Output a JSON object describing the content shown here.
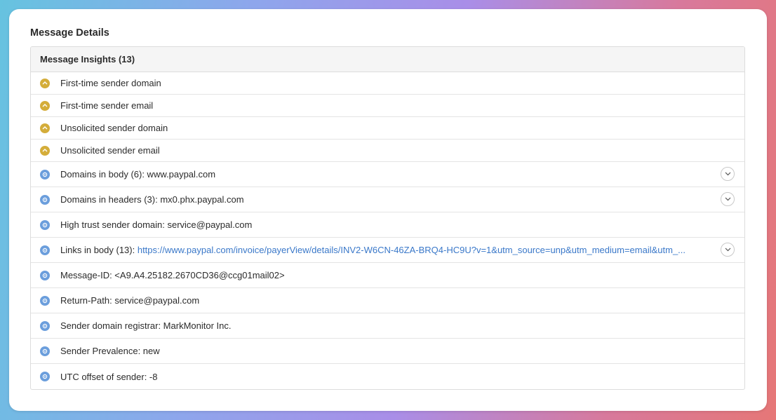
{
  "title": "Message Details",
  "insights_header": "Message Insights (13)",
  "colors": {
    "warning": "#d4ad3a",
    "info": "#6b9edc",
    "link": "#3a78c9"
  },
  "items": [
    {
      "icon": "warning-icon",
      "label": "First-time sender domain"
    },
    {
      "icon": "warning-icon",
      "label": "First-time sender email"
    },
    {
      "icon": "warning-icon",
      "label": "Unsolicited sender domain"
    },
    {
      "icon": "warning-icon",
      "label": "Unsolicited sender email"
    },
    {
      "icon": "info-icon",
      "label": "Domains in body (6): www.paypal.com",
      "expandable": true
    },
    {
      "icon": "info-icon",
      "label": "Domains in headers (3): mx0.phx.paypal.com",
      "expandable": true
    },
    {
      "icon": "info-icon",
      "label": "High trust sender domain: service@paypal.com"
    },
    {
      "icon": "info-icon",
      "label": "Links in body (13): ",
      "link": "https://www.paypal.com/invoice/payerView/details/INV2-W6CN-46ZA-BRQ4-HC9U?v=1&utm_source=unp&utm_medium=email&utm_...",
      "expandable": true
    },
    {
      "icon": "info-icon",
      "label": "Message-ID: <A9.A4.25182.2670CD36@ccg01mail02>"
    },
    {
      "icon": "info-icon",
      "label": "Return-Path: service@paypal.com"
    },
    {
      "icon": "info-icon",
      "label": "Sender domain registrar: MarkMonitor Inc."
    },
    {
      "icon": "info-icon",
      "label": "Sender Prevalence: new"
    },
    {
      "icon": "info-icon",
      "label": "UTC offset of sender: -8"
    }
  ]
}
